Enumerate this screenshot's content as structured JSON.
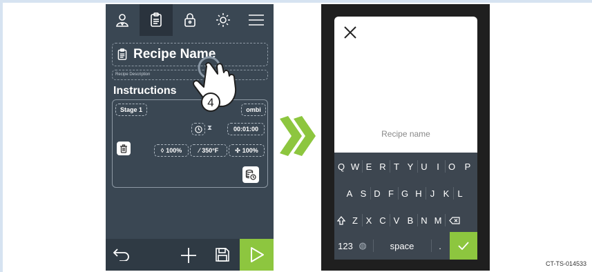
{
  "left_screen": {
    "tabs": [
      {
        "name": "user-icon"
      },
      {
        "name": "recipe-icon",
        "active": true
      },
      {
        "name": "lock-icon"
      },
      {
        "name": "brightness-icon"
      },
      {
        "name": "menu-icon"
      }
    ],
    "recipe_name": "Recipe Name",
    "recipe_description": "Recipe Description",
    "section_title": "Instructions",
    "stage": {
      "label": "Stage 1",
      "mode": "ombi",
      "time": "00:01:00",
      "humidity": "100%",
      "temperature": "350°F",
      "fan": "100%"
    },
    "step_marker": "4",
    "bottom_icons": [
      "back-icon",
      "add-icon",
      "save-icon",
      "play-icon"
    ],
    "accent_color": "#8dc63f"
  },
  "right_screen": {
    "placeholder": "Recipe name",
    "keyboard": {
      "row1": [
        "Q",
        "W",
        "E",
        "R",
        "T",
        "Y",
        "U",
        "I",
        "O",
        "P"
      ],
      "row2": [
        "A",
        "S",
        "D",
        "F",
        "G",
        "H",
        "J",
        "K",
        "L"
      ],
      "row3": [
        "Z",
        "X",
        "C",
        "V",
        "B",
        "N",
        "M"
      ],
      "numbers_key": "123",
      "space_key": "space",
      "period_key": "."
    }
  },
  "figure_code": "CT-TS-014533"
}
